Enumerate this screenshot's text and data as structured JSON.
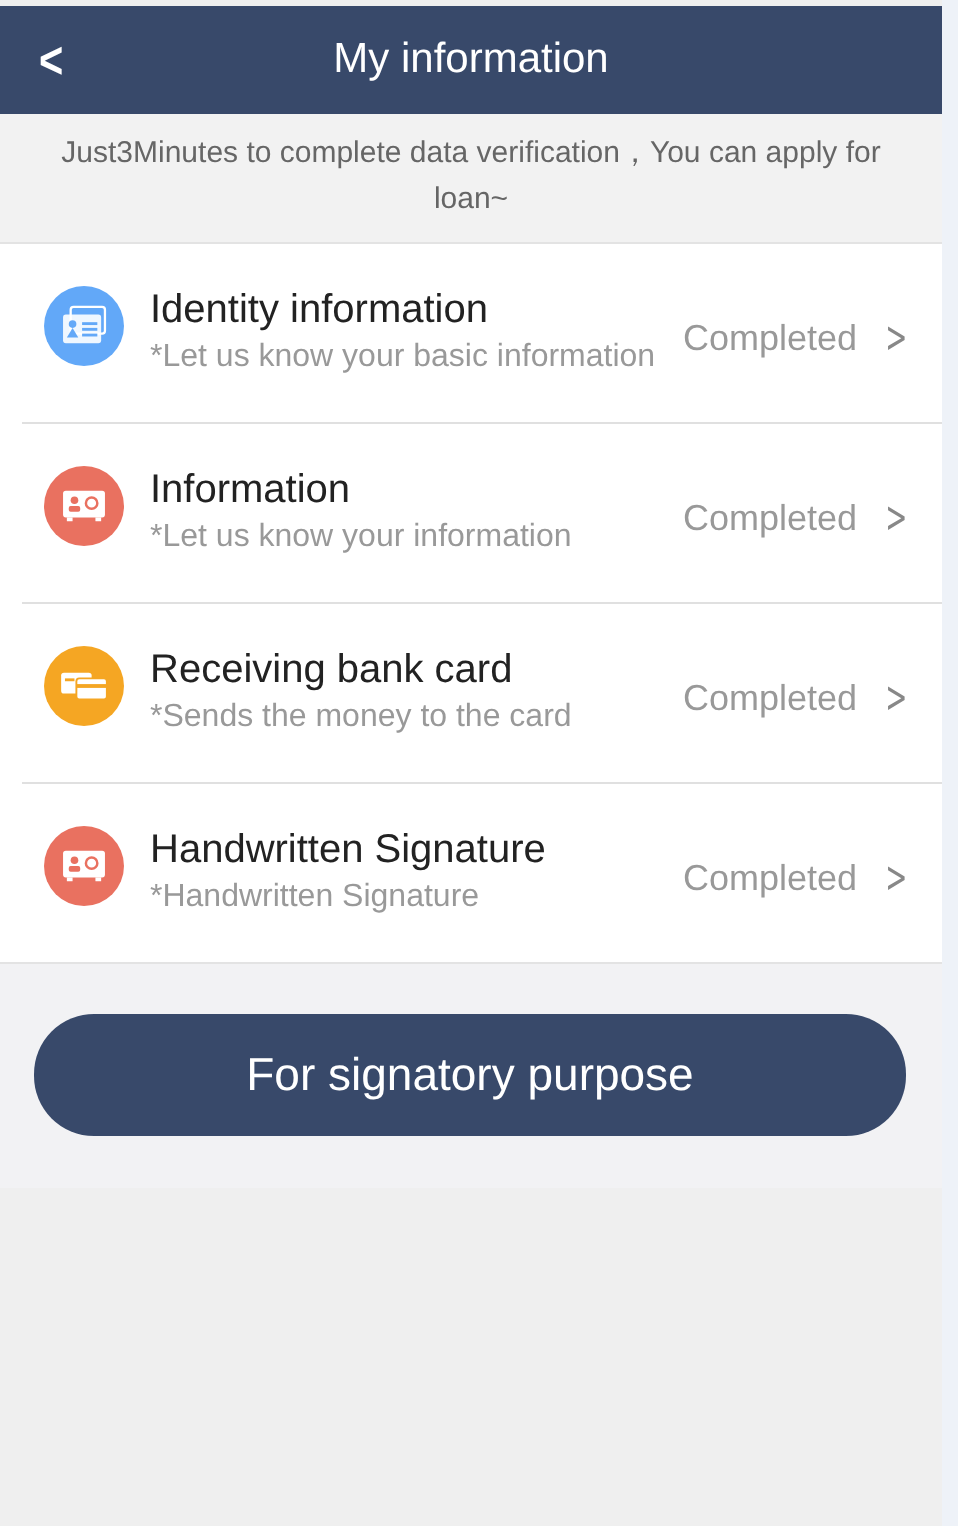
{
  "header": {
    "back": "<",
    "title": "My information"
  },
  "notice": "Just3Minutes to complete data verification，You can apply for loan~",
  "items": [
    {
      "kind": "id-card",
      "color": "#62a8f8",
      "title": "Identity information",
      "subtitle": "*Let us know your basic information",
      "status": "Completed",
      "chevron": ">"
    },
    {
      "kind": "contact-card",
      "color": "#e97160",
      "title": "Information",
      "subtitle": "*Let us know your information",
      "status": "Completed",
      "chevron": ">"
    },
    {
      "kind": "bank-card",
      "color": "#f5a623",
      "title": "Receiving bank card",
      "subtitle": "*Sends the money to the card",
      "status": "Completed",
      "chevron": ">"
    },
    {
      "kind": "contact-card",
      "color": "#e97160",
      "title": "Handwritten Signature",
      "subtitle": "*Handwritten Signature",
      "status": "Completed",
      "chevron": ">"
    }
  ],
  "submit": "For signatory purpose"
}
